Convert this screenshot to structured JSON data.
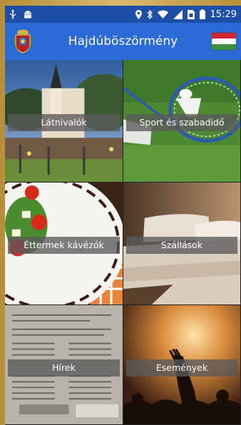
{
  "status": {
    "time": "15:29",
    "colors": {
      "bar": "#1d4fa8"
    }
  },
  "appbar": {
    "title": "Hajdúböszörmény",
    "color": "#2b6bd6",
    "flag_colors": [
      "#d22630",
      "#ffffff",
      "#3f8f3a"
    ]
  },
  "tiles": [
    {
      "label": "Látnivalók"
    },
    {
      "label": "Sport és szabadidő"
    },
    {
      "label": "Éttermek kávézók"
    },
    {
      "label": "Szállások"
    },
    {
      "label": "Hírek"
    },
    {
      "label": "Események"
    }
  ]
}
